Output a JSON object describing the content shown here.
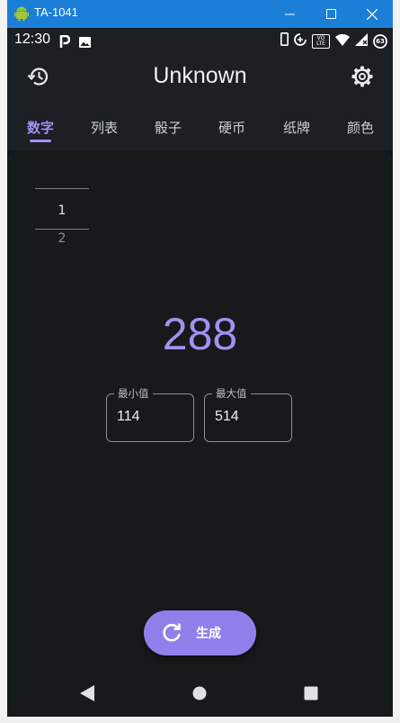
{
  "window": {
    "title": "TA-1041",
    "controls": [
      "minimize",
      "maximize",
      "close"
    ]
  },
  "status_bar": {
    "time": "12:30",
    "left_icons": [
      "parking-icon",
      "image-icon"
    ],
    "right_icons": [
      "phone-icon",
      "data-saver-icon",
      "volte-icon",
      "wifi-icon",
      "signal-icon",
      "battery-icon"
    ],
    "volte_label": "VO LTE",
    "battery_level": "63"
  },
  "app_bar": {
    "title": "Unknown",
    "history_icon": "history-icon",
    "settings_icon": "gear-icon"
  },
  "tabs": [
    {
      "label": "数字",
      "active": true
    },
    {
      "label": "列表",
      "active": false
    },
    {
      "label": "骰子",
      "active": false
    },
    {
      "label": "硬币",
      "active": false
    },
    {
      "label": "纸牌",
      "active": false
    },
    {
      "label": "颜色",
      "active": false
    }
  ],
  "history": {
    "latest": "1",
    "count": "2"
  },
  "result": {
    "value": "288"
  },
  "min_field": {
    "label": "最小值",
    "value": "114"
  },
  "max_field": {
    "label": "最大值",
    "value": "514"
  },
  "generate_button": {
    "label": "生成",
    "icon": "refresh-icon"
  },
  "nav_bar": {
    "buttons": [
      "back-icon",
      "home-icon",
      "recents-icon"
    ]
  },
  "colors": {
    "accent": "#9e93f2",
    "button": "#8f80ec",
    "background": "#171a1b",
    "header": "#1c2024",
    "titlebar": "#1b7fd8"
  }
}
